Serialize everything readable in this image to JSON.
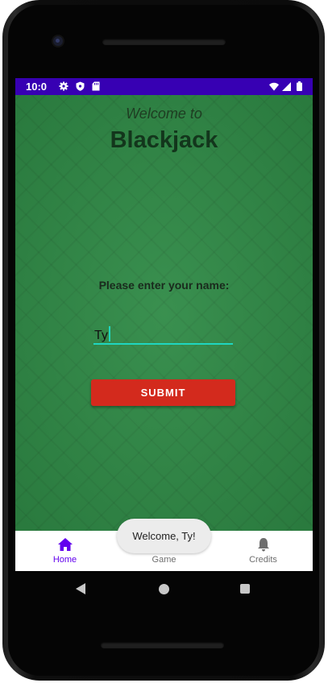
{
  "status_bar": {
    "time": "10:0",
    "icons": [
      "gear-icon",
      "shield-icon",
      "sd-card-icon",
      "wifi-icon",
      "signal-icon",
      "battery-icon"
    ]
  },
  "main": {
    "welcome": "Welcome to",
    "title": "Blackjack",
    "prompt": "Please enter your name:",
    "name_input": {
      "value": "Ty",
      "placeholder": ""
    },
    "submit_label": "SUBMIT"
  },
  "bottom_nav": {
    "items": [
      {
        "label": "Home",
        "icon": "home-icon",
        "active": true
      },
      {
        "label": "Game",
        "icon": "grid-icon",
        "active": false
      },
      {
        "label": "Credits",
        "icon": "bell-icon",
        "active": false
      }
    ]
  },
  "toast": {
    "message": "Welcome, Ty!"
  },
  "colors": {
    "status_bar": "#3700b3",
    "felt": "#2f8a46",
    "submit": "#d32a1d",
    "accent_input": "#1fd6c0",
    "nav_active": "#6200ee",
    "nav_inactive": "#6e6e6e"
  }
}
